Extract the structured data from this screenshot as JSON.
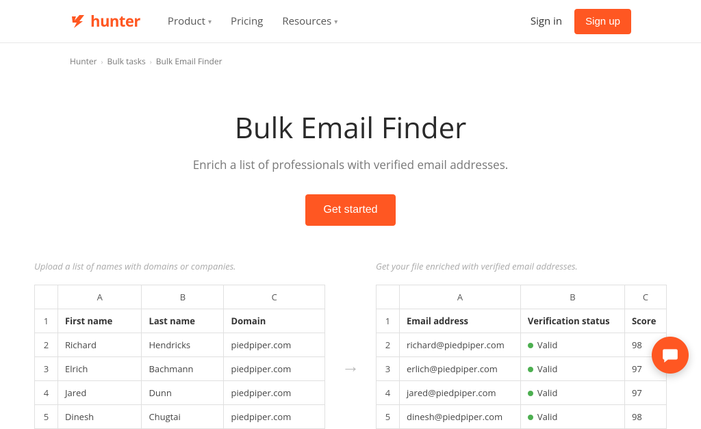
{
  "brand": "hunter",
  "nav": {
    "product": "Product",
    "pricing": "Pricing",
    "resources": "Resources"
  },
  "auth": {
    "signin": "Sign in",
    "signup": "Sign up"
  },
  "breadcrumb": {
    "a": "Hunter",
    "b": "Bulk tasks",
    "c": "Bulk Email Finder"
  },
  "hero": {
    "title": "Bulk Email Finder",
    "subtitle": "Enrich a list of professionals with verified email addresses.",
    "cta": "Get started"
  },
  "left": {
    "caption": "Upload a list of names with domains or companies.",
    "cols": {
      "a": "A",
      "b": "B",
      "c": "C"
    },
    "headers": {
      "first": "First name",
      "last": "Last name",
      "domain": "Domain"
    },
    "rows": [
      {
        "n": "2",
        "first": "Richard",
        "last": "Hendricks",
        "domain": "piedpiper.com"
      },
      {
        "n": "3",
        "first": "Elrich",
        "last": "Bachmann",
        "domain": "piedpiper.com"
      },
      {
        "n": "4",
        "first": "Jared",
        "last": "Dunn",
        "domain": "piedpiper.com"
      },
      {
        "n": "5",
        "first": "Dinesh",
        "last": "Chugtai",
        "domain": "piedpiper.com"
      }
    ]
  },
  "right": {
    "caption": "Get your file enriched with verified email addresses.",
    "cols": {
      "a": "A",
      "b": "B",
      "c": "C"
    },
    "headers": {
      "email": "Email address",
      "status": "Verification status",
      "score": "Score"
    },
    "rows": [
      {
        "n": "2",
        "email": "richard@piedpiper.com",
        "status": "Valid",
        "score": "98"
      },
      {
        "n": "3",
        "email": "erlich@piedpiper.com",
        "status": "Valid",
        "score": "97"
      },
      {
        "n": "4",
        "email": "jared@piedpiper.com",
        "status": "Valid",
        "score": "97"
      },
      {
        "n": "5",
        "email": "dinesh@piedpiper.com",
        "status": "Valid",
        "score": "98"
      }
    ]
  },
  "rownum1": "1"
}
